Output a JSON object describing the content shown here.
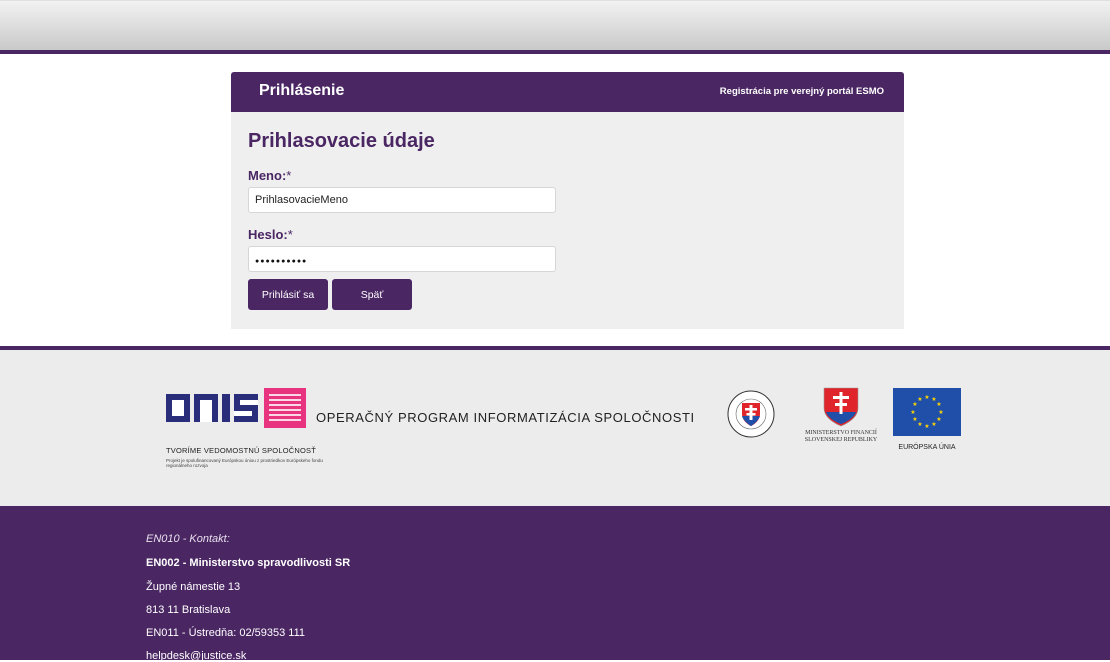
{
  "login": {
    "panel_title": "Prihlásenie",
    "registration_link": "Registrácia pre verejný portál ESMO",
    "section_title": "Prihlasovacie údaje",
    "username_label": "Meno:",
    "required_mark": "*",
    "username_value": "PrihlasovacieMeno",
    "password_label": "Heslo:",
    "password_mask": "●●●●●●●●●●",
    "login_button": "Prihlásiť sa",
    "back_button": "Späť"
  },
  "logos": {
    "opis_text": "OPIS",
    "tagline": "TVORÍME VEDOMOSTNÚ SPOLOČNOSŤ",
    "small_print": "Projekt je spolufinancovaný Európskou úniou z prostriedkov Európskeho fondu regionálneho rozvoja",
    "program_name": "OPERAČNÝ PROGRAM INFORMATIZÁCIA SPOLOČNOSTI",
    "ministry_line1": "MINISTERSTVO FINANCIÍ",
    "ministry_line2": "SLOVENSKEJ REPUBLIKY",
    "eu_label": "EURÓPSKA ÚNIA",
    "colors": {
      "purple": "#4a2663",
      "pink": "#e8347f",
      "opis_blue": "#2a2d7a",
      "eu_blue": "#1f4fa8",
      "eu_star": "#ffd400"
    }
  },
  "contact": {
    "heading": "EN010 - Kontakt:",
    "organization": "EN002 - Ministerstvo spravodlivosti SR",
    "street": "Župné námestie 13",
    "city": "813 11 Bratislava",
    "phone": "EN011 - Ústredňa: 02/59353 111",
    "email": "helpdesk@justice.sk"
  }
}
